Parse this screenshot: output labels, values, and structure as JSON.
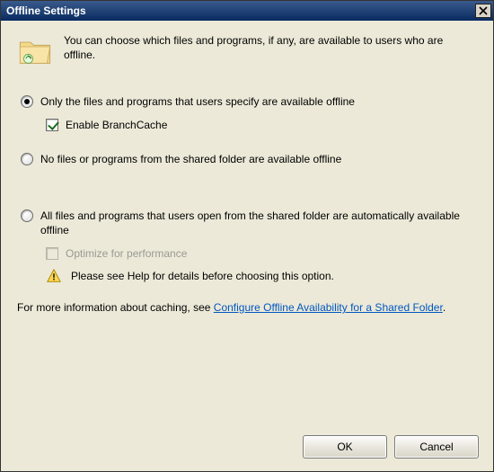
{
  "window": {
    "title": "Offline Settings"
  },
  "intro": "You can choose which files and programs, if any, are available to users who are offline.",
  "options": {
    "opt1": {
      "label": "Only the files and programs that users specify are available offline",
      "selected": true,
      "branchcache": {
        "label": "Enable BranchCache",
        "checked": true
      }
    },
    "opt2": {
      "label": "No files or programs from the shared folder are available offline",
      "selected": false
    },
    "opt3": {
      "label": "All files and programs that users open from the shared folder are automatically available offline",
      "selected": false,
      "optimize": {
        "label": "Optimize for performance",
        "checked": false,
        "enabled": false
      },
      "warning": "Please see Help for details before choosing this option."
    }
  },
  "help": {
    "prefix": "For more information about caching, see ",
    "link": "Configure Offline Availability for a Shared Folder",
    "suffix": "."
  },
  "buttons": {
    "ok": "OK",
    "cancel": "Cancel"
  }
}
